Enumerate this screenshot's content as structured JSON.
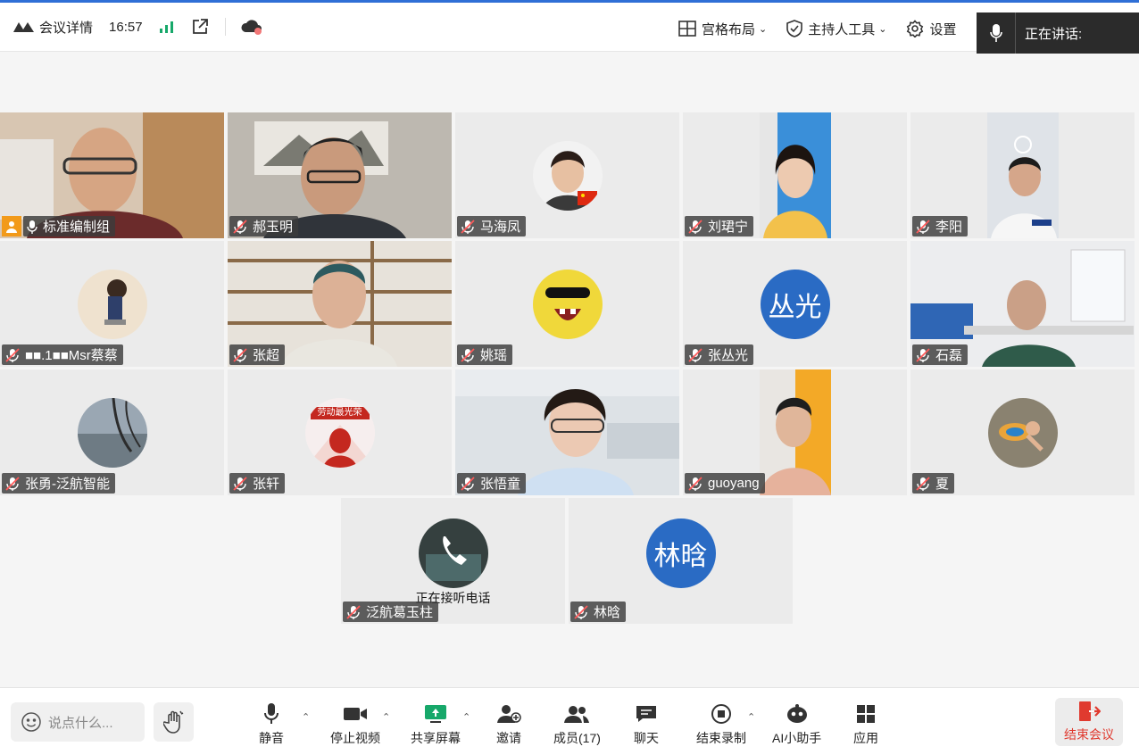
{
  "topbar": {
    "meeting_details": "会议详情",
    "time": "16:57",
    "layout_label": "宫格布局",
    "host_tools_label": "主持人工具",
    "settings_label": "设置",
    "speaking_label": "正在讲话:"
  },
  "participants": [
    {
      "name": "标准编制组",
      "host": true
    },
    {
      "name": "郝玉明"
    },
    {
      "name": "马海凤"
    },
    {
      "name": "刘珺宁"
    },
    {
      "name": "李阳"
    },
    {
      "name": "■■.1■■Msr蔡蔡"
    },
    {
      "name": "张超"
    },
    {
      "name": "姚瑶"
    },
    {
      "name": "张丛光",
      "avatar_text": "丛光"
    },
    {
      "name": "石磊"
    },
    {
      "name": "张勇-泛航智能"
    },
    {
      "name": "张轩",
      "avatar_badge": "劳动最光荣"
    },
    {
      "name": "张悟童"
    },
    {
      "name": "guoyang"
    },
    {
      "name": "夏"
    },
    {
      "name": "泛航葛玉柱",
      "status": "正在接听电话"
    },
    {
      "name": "林晗",
      "avatar_text": "林晗"
    }
  ],
  "toolbar": {
    "say_placeholder": "说点什么...",
    "mute": "静音",
    "stop_video": "停止视频",
    "share_screen": "共享屏幕",
    "invite": "邀请",
    "members": "成员(17)",
    "chat": "聊天",
    "end_record": "结束录制",
    "ai_assistant": "AI小助手",
    "apps": "应用",
    "end_meeting": "结束会议"
  },
  "colors": {
    "accent_blue": "#2a6bc4",
    "end_red": "#e03a2f",
    "share_green": "#17a86a",
    "host_orange": "#f29a1a"
  }
}
